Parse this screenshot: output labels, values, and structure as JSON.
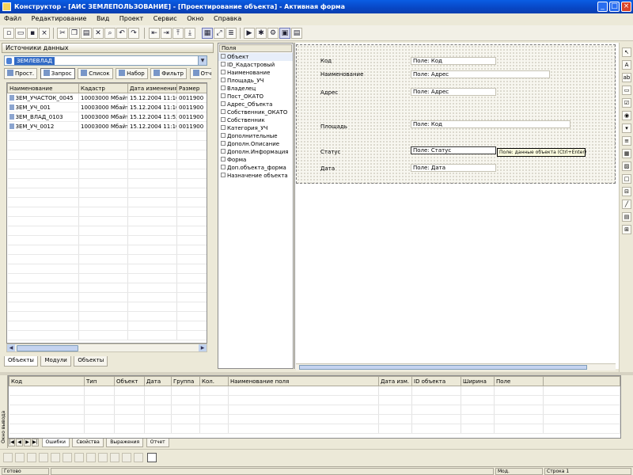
{
  "window": {
    "title": "Конструктор - [АИС ЗЕМЛЕПОЛЬЗОВАНИЕ] - [Проектирование объекта] - Активная форма"
  },
  "menu": {
    "items": [
      "Файл",
      "Редактирование",
      "Вид",
      "Проект",
      "Сервис",
      "Окно",
      "Справка"
    ]
  },
  "left_panel": {
    "title": "Источники данных",
    "combo_value": "ЗЕМЛЕВЛАД",
    "tabs": [
      "Прост.",
      "Запрос",
      "Список",
      "Набор",
      "Фильтр",
      "Отчет"
    ],
    "columns": [
      "Наименование",
      "Кадастр",
      "Дата изменения",
      "Размер"
    ],
    "rows": [
      [
        "ЗЕМ_УЧАСТОК_0045",
        "10003000 Мбайт",
        "15.12.2004 11:10",
        "0011900"
      ],
      [
        "ЗЕМ_УЧ_001",
        "10003000 Мбайт",
        "15.12.2004 11:10",
        "0011900"
      ],
      [
        "ЗЕМ_ВЛАД_0103",
        "10003000 Мбайт",
        "15.12.2004 11:52",
        "0011900"
      ],
      [
        "ЗЕМ_УЧ_0012",
        "10003000 Мбайт",
        "15.12.2004 11:10",
        "0011900"
      ]
    ],
    "bottom_tabs": [
      "Объекты",
      "Модули",
      "Объекты"
    ]
  },
  "tree": {
    "header": "Поля",
    "items": [
      "Объект",
      "ID_Кадастровый",
      "Наименование",
      "Площадь_УЧ",
      "Владелец",
      "Пост_ОКАТО",
      "Адрес_Объекта",
      "Собственник_ОКАТО",
      "Собственник",
      "Категория_УЧ",
      "Дополнительные",
      "Дополн.Описание",
      "Дополн.Информация",
      "Форма",
      "Доп.объекта_форма",
      "Назначение объекта"
    ]
  },
  "design": {
    "fields": [
      {
        "label": "Код",
        "value": "Поле: Код"
      },
      {
        "label": "Наименование",
        "value": "Поле: Адрес"
      },
      {
        "label": "Адрес",
        "value": "Поле: Адрес"
      },
      {
        "label": "Площадь",
        "value": "Поле: Код"
      },
      {
        "label": "Статус",
        "value": "Поле: Статус"
      },
      {
        "label": "Дата",
        "value": "Поле: Дата"
      }
    ],
    "tooltip": "Поле: данные объекта (Ctrl+Enter)"
  },
  "output": {
    "columns": [
      "Код",
      "Тип",
      "Объект",
      "Дата",
      "Группа",
      "Кол.",
      "Наименование поля",
      "Дата изм.",
      "ID объекта",
      "Ширина",
      "Поле"
    ],
    "tabs": [
      "Ошибки",
      "Свойства",
      "Выражения",
      "Отчет"
    ],
    "side_label": "Окно вывода"
  },
  "status": {
    "panels": [
      "Готово",
      "",
      "Мод.",
      "Строка 1"
    ]
  }
}
